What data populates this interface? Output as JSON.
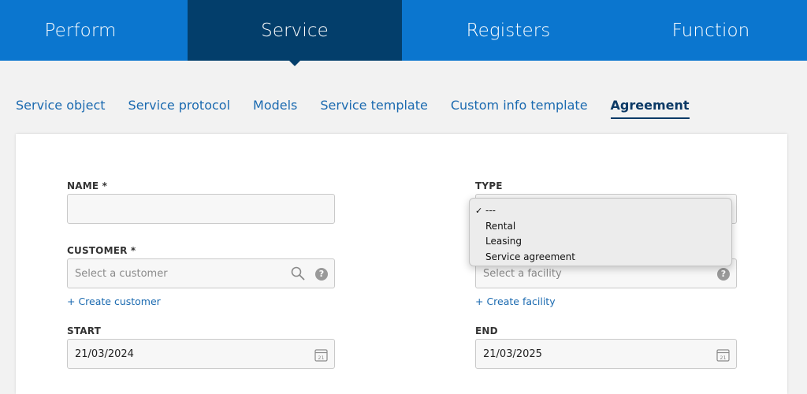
{
  "topnav": {
    "tabs": [
      {
        "label": "Perform"
      },
      {
        "label": "Service"
      },
      {
        "label": "Registers"
      },
      {
        "label": "Function"
      }
    ]
  },
  "subtabs": [
    {
      "label": "Service object"
    },
    {
      "label": "Service protocol"
    },
    {
      "label": "Models"
    },
    {
      "label": "Service template"
    },
    {
      "label": "Custom info template"
    },
    {
      "label": "Agreement"
    }
  ],
  "form": {
    "name": {
      "label": "NAME *",
      "value": ""
    },
    "type": {
      "label": "TYPE",
      "selected": "---"
    },
    "customer": {
      "label": "CUSTOMER *",
      "placeholder": "Select a customer",
      "create_link": "+ Create customer",
      "help": "?"
    },
    "facility": {
      "placeholder": "Select a facility",
      "create_link": "+ Create facility",
      "help": "?"
    },
    "start": {
      "label": "START",
      "value": "21/03/2024"
    },
    "end": {
      "label": "END",
      "value": "21/03/2025"
    },
    "calendar_day": "21"
  },
  "type_menu": {
    "check": "✓",
    "options": [
      "---",
      "Rental",
      "Leasing",
      "Service agreement"
    ]
  },
  "colors": {
    "nav_bg": "#0b76cf",
    "nav_active": "#033e6b",
    "link": "#1b6ab0"
  },
  "icons": [
    "search-icon",
    "help-icon",
    "calendar-icon",
    "checkmark-icon"
  ]
}
